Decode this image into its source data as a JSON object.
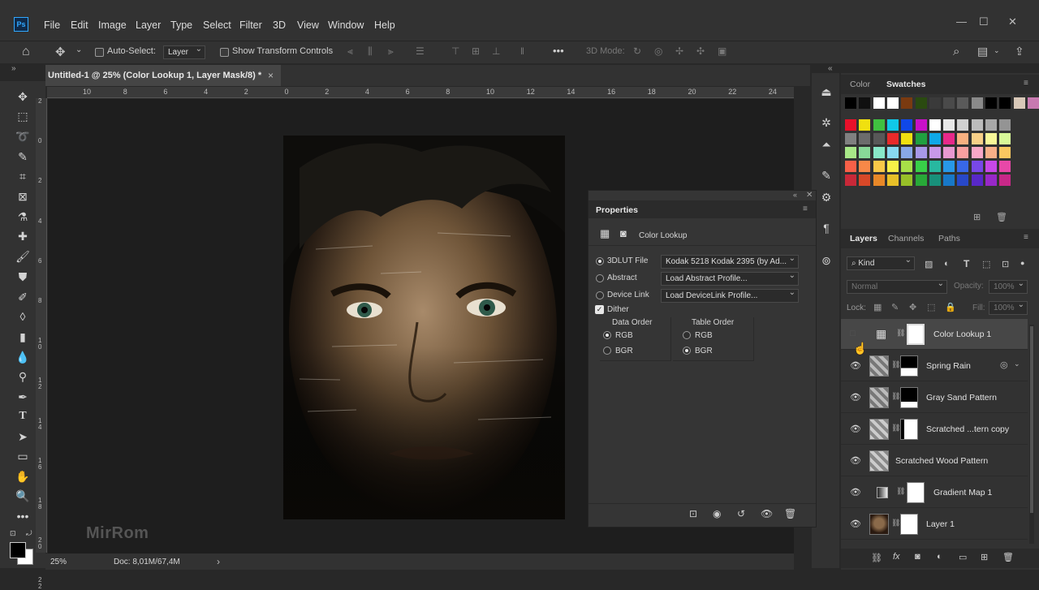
{
  "app": {
    "logo": "Ps"
  },
  "menu": [
    "File",
    "Edit",
    "Image",
    "Layer",
    "Type",
    "Select",
    "Filter",
    "3D",
    "View",
    "Window",
    "Help"
  ],
  "window_controls": {
    "min": "—",
    "max": "☐",
    "close": "✕"
  },
  "options": {
    "auto_select_label": "Auto-Select:",
    "auto_select_value": "Layer",
    "show_transform_label": "Show Transform Controls",
    "more": "•••",
    "three_d_mode": "3D Mode:"
  },
  "document": {
    "tab_title": "Untitled-1 @ 25% (Color Lookup 1, Layer Mask/8) *",
    "tab_close": "×",
    "ruler_top_ticks": [
      "10",
      "8",
      "6",
      "4",
      "2",
      "0",
      "2",
      "4",
      "6",
      "8",
      "10",
      "12",
      "14",
      "16",
      "18",
      "20",
      "22",
      "24"
    ],
    "ruler_left_ticks": [
      "2",
      "0",
      "2",
      "4",
      "6",
      "8",
      "1\n0",
      "1\n2",
      "1\n4",
      "1\n6",
      "1\n8",
      "2\n0",
      "2\n2"
    ],
    "watermark": "MirRom"
  },
  "status": {
    "zoom": "25%",
    "doc": "Doc: 8,01M/67,4M",
    "arrow": "›"
  },
  "properties": {
    "title": "Properties",
    "adj_title": "Color Lookup",
    "options": [
      {
        "label": "3DLUT File",
        "value": "Kodak 5218 Kodak 2395 (by Ad...",
        "selected": true
      },
      {
        "label": "Abstract",
        "value": "Load Abstract Profile...",
        "selected": false
      },
      {
        "label": "Device Link",
        "value": "Load DeviceLink Profile...",
        "selected": false
      }
    ],
    "dither_label": "Dither",
    "dither_checked": true,
    "data_order": {
      "label": "Data Order",
      "options": [
        "RGB",
        "BGR"
      ],
      "selected": "RGB"
    },
    "table_order": {
      "label": "Table Order",
      "options": [
        "RGB",
        "BGR"
      ],
      "selected": "BGR"
    }
  },
  "color_panel": {
    "tabs": [
      "Color",
      "Swatches"
    ],
    "active": "Swatches"
  },
  "swatches": {
    "row1": [
      "#000000",
      "#101010",
      "#ffffff",
      "#ffffff",
      "#7a3a10",
      "#2a4a10",
      "#3a3a3a",
      "#4a4a4a",
      "#5a5a5a",
      "#8a8a8a",
      "#000000",
      "#000000",
      "#d8c8b8",
      "#c87ab0"
    ],
    "row2": [
      "#e8102a",
      "#f0e010",
      "#40c040",
      "#10c8e8",
      "#1048e8",
      "#c810c8",
      "#ffffff",
      "#e8e8e8",
      "#d0d0d0",
      "#bcbcbc",
      "#a8a8a8",
      "#949494"
    ],
    "row3": [
      "#808080",
      "#6c6c6c",
      "#585858",
      "#e82a2a",
      "#f0e010",
      "#20a040",
      "#10a8e8",
      "#e8288a",
      "#f8b080",
      "#f8d088",
      "#f8f898",
      "#d8f898"
    ],
    "row4": [
      "#a8e888",
      "#88d898",
      "#88e8c8",
      "#88d8f0",
      "#88a8e8",
      "#a898e8",
      "#c898e8",
      "#e898d0",
      "#f8a0a0",
      "#f8a8c8",
      "#f8b088",
      "#f8c860"
    ],
    "row5": [
      "#f86048",
      "#f88848",
      "#f8c848",
      "#f8f048",
      "#a8e048",
      "#38d048",
      "#28b8a0",
      "#2898e8",
      "#3868e8",
      "#7848e8",
      "#c848e8",
      "#e848a8"
    ],
    "row6": [
      "#c82838",
      "#d84828",
      "#e88828",
      "#e8c028",
      "#98c028",
      "#28a838",
      "#18907a",
      "#1878c8",
      "#2848c8",
      "#5828c8",
      "#9828c8",
      "#c82888"
    ]
  },
  "layers_panel": {
    "tabs": [
      "Layers",
      "Channels",
      "Paths"
    ],
    "active": "Layers",
    "kind": "Kind",
    "blend": "Normal",
    "opacity_label": "Opacity:",
    "opacity_value": "100%",
    "lock_label": "Lock:",
    "fill_label": "Fill:",
    "fill_value": "100%",
    "layers": [
      {
        "name": "Color Lookup 1",
        "visible": false,
        "selected": true
      },
      {
        "name": "Spring Rain",
        "visible": true
      },
      {
        "name": "Gray Sand Pattern",
        "visible": true
      },
      {
        "name": "Scratched ...tern copy",
        "visible": true
      },
      {
        "name": "Scratched Wood Pattern",
        "visible": true
      },
      {
        "name": "Gradient Map 1",
        "visible": true
      },
      {
        "name": "Layer 1",
        "visible": true
      }
    ]
  }
}
